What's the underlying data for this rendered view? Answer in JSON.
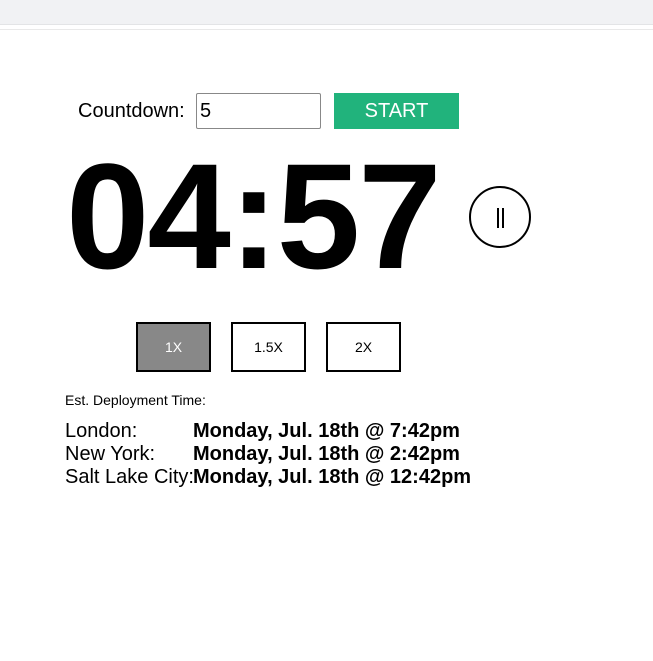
{
  "countdown": {
    "label": "Countdown:",
    "value": "5",
    "start_label": "START"
  },
  "timer": {
    "display": "04:57",
    "pause_label": "||"
  },
  "speed": {
    "options": [
      "1X",
      "1.5X",
      "2X"
    ],
    "selected": "1X"
  },
  "deployment": {
    "label": "Est. Deployment Time:",
    "rows": [
      {
        "city": "London:",
        "time": "Monday, Jul. 18th @ 7:42pm"
      },
      {
        "city": "New York:",
        "time": "Monday, Jul. 18th @ 2:42pm"
      },
      {
        "city": "Salt Lake City:",
        "time": "Monday, Jul. 18th @ 12:42pm"
      }
    ]
  },
  "colors": {
    "start_button": "#21b37c",
    "active_speed": "#888888"
  }
}
